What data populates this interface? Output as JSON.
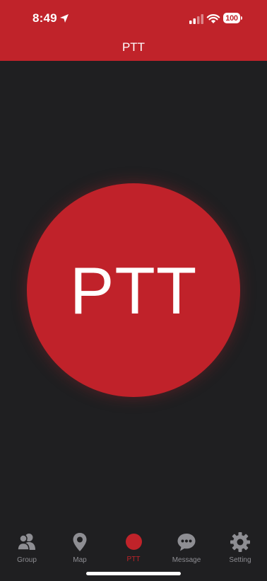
{
  "status_bar": {
    "time": "8:49",
    "battery": "100",
    "icons": [
      "location-arrow-icon",
      "cellular-signal-icon",
      "wifi-icon",
      "battery-icon"
    ]
  },
  "header": {
    "title": "PTT"
  },
  "main": {
    "ptt_button_label": "PTT"
  },
  "tabbar": {
    "items": [
      {
        "label": "Group",
        "icon": "group-icon",
        "active": false
      },
      {
        "label": "Map",
        "icon": "map-pin-icon",
        "active": false
      },
      {
        "label": "PTT",
        "icon": "ptt-dot-icon",
        "active": true
      },
      {
        "label": "Message",
        "icon": "message-icon",
        "active": false
      },
      {
        "label": "Setting",
        "icon": "gear-icon",
        "active": false
      }
    ]
  },
  "colors": {
    "accent": "#c0232a",
    "background": "#1f1f21",
    "inactive_tab": "#8e8e93",
    "text_on_accent": "#ffffff"
  }
}
